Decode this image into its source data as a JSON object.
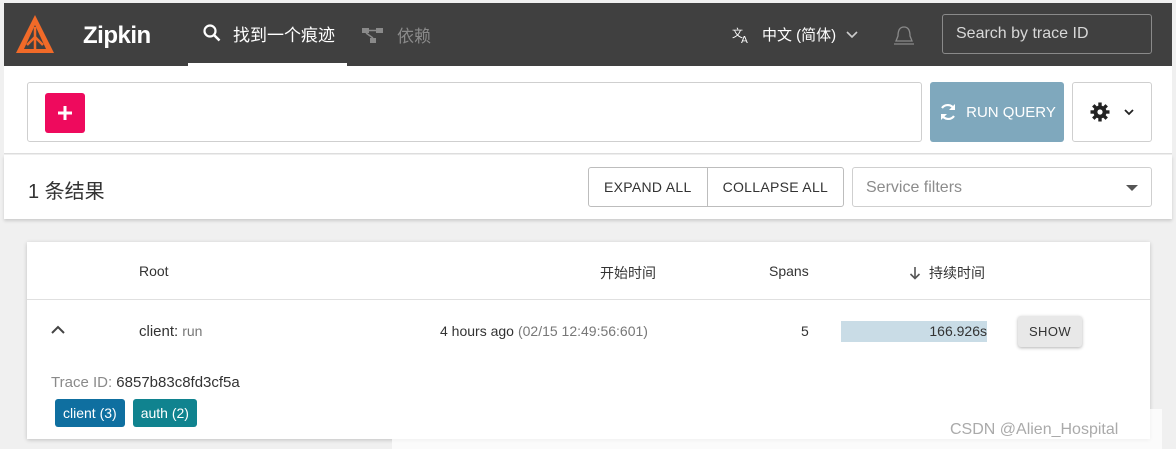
{
  "header": {
    "brand": "Zipkin",
    "nav": {
      "find_trace": "找到一个痕迹",
      "dependencies": "依赖"
    },
    "language": "中文 (简体)",
    "search_placeholder": "Search by trace ID"
  },
  "query": {
    "run_label": "RUN QUERY"
  },
  "results": {
    "count_label": "1 条结果",
    "expand_all": "EXPAND ALL",
    "collapse_all": "COLLAPSE ALL",
    "service_filter_placeholder": "Service filters"
  },
  "table": {
    "headers": {
      "root": "Root",
      "start_time": "开始时间",
      "spans": "Spans",
      "duration": "持续时间"
    },
    "rows": [
      {
        "service": "client:",
        "span_name": "run",
        "start_relative": "4 hours ago",
        "start_absolute": "(02/15 12:49:56:601)",
        "spans": "5",
        "duration": "166.926s",
        "duration_fraction": 1.0,
        "show_label": "SHOW",
        "trace_id_label": "Trace ID:",
        "trace_id": "6857b83c8fd3cf5a",
        "badges": [
          {
            "label": "client (3)",
            "color": "#0f6fa0"
          },
          {
            "label": "auth (2)",
            "color": "#10838f"
          }
        ]
      }
    ]
  },
  "watermark": "CSDN @Alien_Hospital",
  "colors": {
    "header_bg": "#404040",
    "add_button": "#ee0a5d",
    "run_button": "#7fa8bd",
    "duration_bar": "#c9dce6",
    "logo": "#f16a28"
  }
}
